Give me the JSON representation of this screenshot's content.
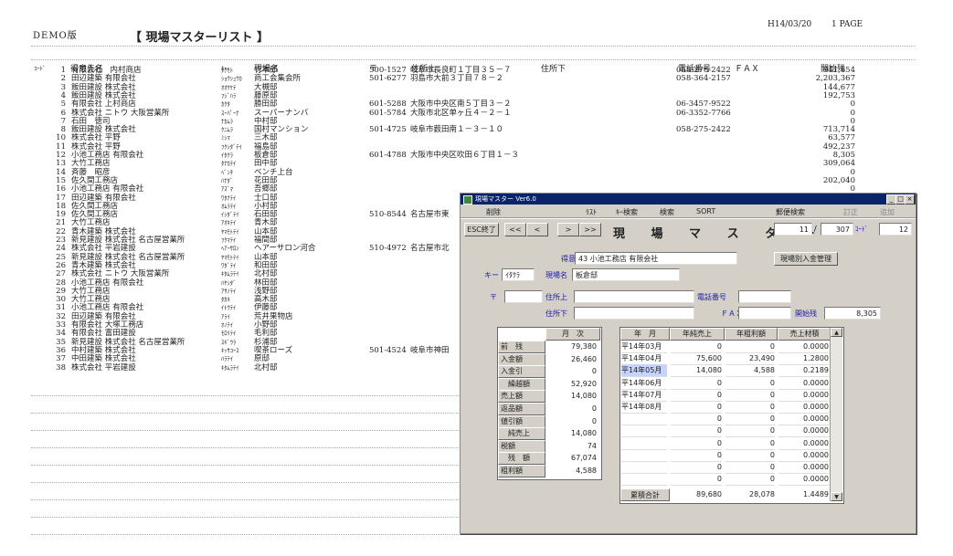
{
  "report": {
    "demo": "DEMO版",
    "title": "【 現場マスターリスト 】",
    "date": "H14/03/20",
    "page": "1 PAGE",
    "headers": {
      "code": "ｺｰﾄﾞ",
      "client": "得意先名",
      "key": "ｷｰ-",
      "site": "現場名",
      "zip": "〒",
      "addr1": "住所上",
      "addr2": "住所下",
      "tel": "電話番号",
      "fax": "ＦＡＸ",
      "start": "開始残"
    },
    "rows": [
      {
        "no": "1",
        "client": "有限会社　内村商店",
        "key": "ﾀｹﾓﾄ",
        "site": "竹本邸",
        "zip": "500-1527",
        "addr": "岐阜市長良町１丁目３５－７",
        "tel": "058-276-2422",
        "amt": "941,654"
      },
      {
        "no": "2",
        "client": "田辺建築 有限会社",
        "key": "ｼｮｳｼｭｳｶ",
        "site": "商工会集会所",
        "zip": "501-6277",
        "addr": "羽島市大前３丁目７８－２",
        "tel": "058-364-2157",
        "amt": "2,203,367"
      },
      {
        "no": "3",
        "client": "飯田建設 株式会社",
        "key": "ｵｵｸｹﾃ",
        "site": "大槻邸",
        "zip": "",
        "addr": "",
        "tel": "",
        "amt": "144,677"
      },
      {
        "no": "4",
        "client": "飯田建設 株式会社",
        "key": "ﾌｼﾞﾊﾗ",
        "site": "藤原邸",
        "zip": "",
        "addr": "",
        "tel": "",
        "amt": "192,753"
      },
      {
        "no": "5",
        "client": "有限会社 上村商店",
        "key": "ｶｸﾀ",
        "site": "勝田邸",
        "zip": "601-5288",
        "addr": "大阪市中央区南５丁目３－２",
        "tel": "06-3457-9522",
        "amt": "0"
      },
      {
        "no": "6",
        "client": "株式会社 ニトウ 大阪営業所",
        "key": "ｽｰﾊﾟｰﾅ",
        "site": "スーパーナンバ",
        "zip": "601-5784",
        "addr": "大阪市北区单ヶ丘４－２－１",
        "tel": "06-3352-7766",
        "amt": "0"
      },
      {
        "no": "7",
        "client": "石田　徳司",
        "key": "ﾅｶﾑﾗ",
        "site": "中村邸",
        "zip": "",
        "addr": "",
        "tel": "",
        "amt": "0"
      },
      {
        "no": "8",
        "client": "飯田建設 株式会社",
        "key": "ｸﾆﾑﾗ",
        "site": "国村マンション",
        "zip": "501-4725",
        "addr": "岐阜市薮田南１－３－１０",
        "tel": "058-275-2422",
        "amt": "713,714"
      },
      {
        "no": "10",
        "client": "株式会社 平野",
        "key": "ﾐｼﾏ",
        "site": "三木邸",
        "zip": "",
        "addr": "",
        "tel": "",
        "amt": "63,577"
      },
      {
        "no": "11",
        "client": "株式会社 平野",
        "key": "ﾌｸｼﾀﾞﾃｲ",
        "site": "福島邸",
        "zip": "",
        "addr": "",
        "tel": "",
        "amt": "492,237"
      },
      {
        "no": "12",
        "client": "小池工務店 有限会社",
        "key": "ｲﾀｸﾗ",
        "site": "板倉邸",
        "zip": "601-4788",
        "addr": "大阪市中央区吹田６丁目１－３",
        "tel": "",
        "amt": "8,305"
      },
      {
        "no": "13",
        "client": "大竹工務店",
        "key": "ﾀﾅｶﾃｲ",
        "site": "田中邸",
        "zip": "",
        "addr": "",
        "tel": "",
        "amt": "309,064"
      },
      {
        "no": "14",
        "client": "斉藤　昭彦",
        "key": "ﾍﾞﾝﾁ",
        "site": "ベンチ上台",
        "zip": "",
        "addr": "",
        "tel": "",
        "amt": "0"
      },
      {
        "no": "15",
        "client": "佐久間工務店",
        "key": "ﾊﾅﾀﾞ",
        "site": "花田邸",
        "zip": "",
        "addr": "",
        "tel": "",
        "amt": "202,040"
      },
      {
        "no": "16",
        "client": "小池工務店 有限会社",
        "key": "ｱｽﾞﾏ",
        "site": "吾郷邸",
        "zip": "",
        "addr": "",
        "tel": "",
        "amt": "0"
      },
      {
        "no": "17",
        "client": "田辺建築 有限会社",
        "key": "ﾜﾀﾅﾃｲ",
        "site": "士口邸",
        "zip": "",
        "addr": "",
        "tel": "",
        "amt": ""
      },
      {
        "no": "18",
        "client": "佐久間工務店",
        "key": "ｵﾑﾗﾃｲ",
        "site": "小村邸",
        "zip": "",
        "addr": "",
        "tel": "",
        "amt": ""
      },
      {
        "no": "19",
        "client": "佐久間工務店",
        "key": "ｲｼﾀﾞﾃｲ",
        "site": "石田邸",
        "zip": "510-8544",
        "addr": "名古屋市東",
        "tel": "",
        "amt": ""
      },
      {
        "no": "21",
        "client": "大竹工務店",
        "key": "ｱｵｷﾃｲ",
        "site": "青木邸",
        "zip": "",
        "addr": "",
        "tel": "",
        "amt": ""
      },
      {
        "no": "22",
        "client": "青木建築 株式会社",
        "key": "ﾔﾏﾓﾄﾃｲ",
        "site": "山本邸",
        "zip": "",
        "addr": "",
        "tel": "",
        "amt": ""
      },
      {
        "no": "23",
        "client": "新見建設 株式会社 名古屋営業所",
        "key": "ﾌｸﾏﾃｲ",
        "site": "福間邸",
        "zip": "",
        "addr": "",
        "tel": "",
        "amt": ""
      },
      {
        "no": "24",
        "client": "株式会社 平岩建設",
        "key": "ﾍｱｰｻﾛﾝ",
        "site": "ヘアーサロン河合",
        "zip": "510-4972",
        "addr": "名古屋市北",
        "tel": "",
        "amt": ""
      },
      {
        "no": "25",
        "client": "新見建設 株式会社 名古屋営業所",
        "key": "ﾔﾏﾓﾄﾃｲ",
        "site": "山本邸",
        "zip": "",
        "addr": "",
        "tel": "",
        "amt": ""
      },
      {
        "no": "26",
        "client": "青木建築 株式会社",
        "key": "ﾜﾀﾞﾃｲ",
        "site": "和田邸",
        "zip": "",
        "addr": "",
        "tel": "",
        "amt": ""
      },
      {
        "no": "27",
        "client": "株式会社 ニトウ 大阪営業所",
        "key": "ｷﾀﾑﾗﾃｲ",
        "site": "北村邸",
        "zip": "",
        "addr": "",
        "tel": "",
        "amt": ""
      },
      {
        "no": "28",
        "client": "小池工務店 有限会社",
        "key": "ﾊﾔｼﾀﾞ",
        "site": "林田邸",
        "zip": "",
        "addr": "",
        "tel": "",
        "amt": ""
      },
      {
        "no": "29",
        "client": "大竹工務店",
        "key": "ｱｻﾉﾃｲ",
        "site": "浅野邸",
        "zip": "",
        "addr": "",
        "tel": "",
        "amt": ""
      },
      {
        "no": "30",
        "client": "大竹工務店",
        "key": "ﾀｶｷ",
        "site": "高木邸",
        "zip": "",
        "addr": "",
        "tel": "",
        "amt": ""
      },
      {
        "no": "31",
        "client": "小池工務店 有限会社",
        "key": "ｲﾄｳﾃｲ",
        "site": "伊藤邸",
        "zip": "",
        "addr": "",
        "tel": "",
        "amt": ""
      },
      {
        "no": "32",
        "client": "田辺建築 有限会社",
        "key": "ｱﾗｲ",
        "site": "荒井果物店",
        "zip": "",
        "addr": "",
        "tel": "",
        "amt": ""
      },
      {
        "no": "33",
        "client": "有限会社 大塚工務店",
        "key": "ｵﾉﾃｲ",
        "site": "小野邸",
        "zip": "",
        "addr": "",
        "tel": "",
        "amt": ""
      },
      {
        "no": "34",
        "client": "有限会社 富田建設",
        "key": "ﾓﾛﾘﾃｲ",
        "site": "毛利邸",
        "zip": "",
        "addr": "",
        "tel": "",
        "amt": ""
      },
      {
        "no": "35",
        "client": "新見建設 株式会社 名古屋営業所",
        "key": "ｽｷﾞｳﾗ",
        "site": "杉浦邸",
        "zip": "",
        "addr": "",
        "tel": "",
        "amt": ""
      },
      {
        "no": "36",
        "client": "中村建築 株式会社",
        "key": "ｷｯｻｺｰｽ",
        "site": "喫茶ローズ",
        "zip": "501-4524",
        "addr": "岐阜市神田",
        "tel": "",
        "amt": ""
      },
      {
        "no": "37",
        "client": "中田建築 株式会社",
        "key": "ﾊﾗﾃｲ",
        "site": "原邸",
        "zip": "",
        "addr": "",
        "tel": "",
        "amt": ""
      },
      {
        "no": "38",
        "client": "株式会社 平岩建設",
        "key": "ｷﾀﾑﾗﾃｲ",
        "site": "北村邸",
        "zip": "",
        "addr": "",
        "tel": "",
        "amt": ""
      }
    ]
  },
  "dialog": {
    "window_title": "現場マスター Ver6.0",
    "menu": [
      "削除",
      "ﾘｽﾄ",
      "ｷｰ検索",
      "検索",
      "SORT",
      "郵便検索",
      "訂正",
      "追加"
    ],
    "nav": {
      "esc": "ESC終了",
      "first": "<<",
      "prev": "<",
      "next": ">",
      "last": ">>"
    },
    "title": "現 場 マ ス タ ー",
    "record": {
      "current": "11",
      "sep": "/",
      "total": "307",
      "code_label": "ｺｰﾄﾞ",
      "code": "12"
    },
    "form": {
      "client_label": "得意先名",
      "client_value": "43 小池工務店 有限会社",
      "deposit_btn": "現場別入金管理",
      "key_label": "キー",
      "key_value": "ｲﾀｸﾗ",
      "site_label": "現場名",
      "site_value": "板倉邸",
      "zip_label": "〒",
      "addr1_label": "住所上",
      "tel_label": "電話番号",
      "addr2_label": "住所下",
      "fax_label": "ＦＡＸ",
      "start_label": "開始残",
      "start_value": "8,305"
    },
    "monthly": {
      "header": "月　次",
      "rows": [
        {
          "label": "前　残",
          "value": "79,380"
        },
        {
          "label": "入金額",
          "value": "26,460"
        },
        {
          "label": "入金引",
          "value": "0"
        },
        {
          "label": "　繰越額",
          "value": "52,920"
        },
        {
          "label": "売上額",
          "value": "14,080"
        },
        {
          "label": "返品額",
          "value": "0"
        },
        {
          "label": "値引額",
          "value": "0"
        },
        {
          "label": "　純売上",
          "value": "14,080"
        },
        {
          "label": "税額",
          "value": "74"
        },
        {
          "label": "　残　額",
          "value": "67,074"
        },
        {
          "label": "粗利額",
          "value": "4,588"
        }
      ]
    },
    "yearly": {
      "headers": [
        "年　月",
        "年純売上",
        "年粗利額",
        "売上材積"
      ],
      "rows": [
        [
          "平14年03月",
          "0",
          "0",
          "0.0000"
        ],
        [
          "平14年04月",
          "75,600",
          "23,490",
          "1.2800"
        ],
        [
          "平14年05月",
          "14,080",
          "4,588",
          "0.2189"
        ],
        [
          "平14年06月",
          "0",
          "0",
          "0.0000"
        ],
        [
          "平14年07月",
          "0",
          "0",
          "0.0000"
        ],
        [
          "平14年08月",
          "0",
          "0",
          "0.0000"
        ],
        [
          "",
          "0",
          "0",
          "0.0000"
        ],
        [
          "",
          "0",
          "0",
          "0.0000"
        ],
        [
          "",
          "0",
          "0",
          "0.0000"
        ],
        [
          "",
          "0",
          "0",
          "0.0000"
        ],
        [
          "",
          "0",
          "0",
          "0.0000"
        ],
        [
          "",
          "0",
          "0",
          "0.0000"
        ]
      ],
      "total": [
        "累積合計",
        "89,680",
        "28,078",
        "1.4489"
      ]
    }
  }
}
